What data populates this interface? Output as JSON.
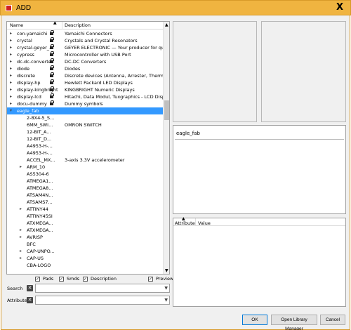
{
  "window": {
    "title": "ADD",
    "close": "X"
  },
  "tree": {
    "headers": {
      "name": "Name",
      "description": "Description"
    },
    "rows": [
      {
        "name": "con-yamaichi",
        "desc": "Yamaichi Connectors",
        "arrow": "▸",
        "lock": true
      },
      {
        "name": "crystal",
        "desc": "Crystals and Crystal Resonators",
        "arrow": "▸",
        "lock": true
      },
      {
        "name": "crystal-geyer_...",
        "desc": "GEYER ELECTRONIC — Your producer for quartz ...",
        "arrow": "▸",
        "lock": true
      },
      {
        "name": "cypress",
        "desc": "Microcontroller with USB Port",
        "arrow": "▸",
        "lock": true
      },
      {
        "name": "dc-dc-converter",
        "desc": "DC-DC Converters",
        "arrow": "▸",
        "lock": true
      },
      {
        "name": "diode",
        "desc": "Diodes",
        "arrow": "▸",
        "lock": true
      },
      {
        "name": "discrete",
        "desc": "Discrete devices (Antenna, Arrester, Thermistor)",
        "arrow": "▸",
        "lock": true
      },
      {
        "name": "display-hp",
        "desc": "Hewlett Packard LED Displays",
        "arrow": "▸",
        "lock": true
      },
      {
        "name": "display-kingbright",
        "desc": "KINGBRIGHT Numeric Displays",
        "arrow": "▸",
        "lock": true
      },
      {
        "name": "display-lcd",
        "desc": "Hitachi, Data Modul, Tuxgraphics - LCD Displays",
        "arrow": "▸",
        "lock": true
      },
      {
        "name": "docu-dummy",
        "desc": "Dummy symbols",
        "arrow": "▸",
        "lock": true
      },
      {
        "name": "eagle_fab",
        "desc": "",
        "arrow": "▾",
        "lock": false,
        "selected": true
      },
      {
        "name": "2-8X4-5_S...",
        "desc": "",
        "arrow": "",
        "child": true
      },
      {
        "name": "6MM_SWI...",
        "desc": "OMRON SWITCH",
        "arrow": "",
        "child": true
      },
      {
        "name": "12-BIT_A...",
        "desc": "",
        "arrow": "",
        "child": true
      },
      {
        "name": "12-BIT_D...",
        "desc": "",
        "arrow": "",
        "child": true
      },
      {
        "name": "A4953-H-...",
        "desc": "",
        "arrow": "",
        "child": true
      },
      {
        "name": "A4953-H-...",
        "desc": "",
        "arrow": "",
        "child": true
      },
      {
        "name": "ACCEL_MX...",
        "desc": "3-axis 3.3V accelerometer",
        "arrow": "",
        "child": true
      },
      {
        "name": "ARM_10",
        "desc": "",
        "arrow": "▸",
        "child": true
      },
      {
        "name": "AS5304-6",
        "desc": "",
        "arrow": "",
        "child": true
      },
      {
        "name": "ATMEGA1...",
        "desc": "",
        "arrow": "",
        "child": true
      },
      {
        "name": "ATMEGA8...",
        "desc": "",
        "arrow": "",
        "child": true
      },
      {
        "name": "ATSAM4N...",
        "desc": "",
        "arrow": "",
        "child": true
      },
      {
        "name": "ATSAMS7...",
        "desc": "",
        "arrow": "",
        "child": true
      },
      {
        "name": "ATTINY44",
        "desc": "",
        "arrow": "▸",
        "child": true
      },
      {
        "name": "ATTINY45SI",
        "desc": "",
        "arrow": "",
        "child": true
      },
      {
        "name": "ATXMEGA...",
        "desc": "",
        "arrow": "",
        "child": true
      },
      {
        "name": "ATXMEGA...",
        "desc": "",
        "arrow": "▸",
        "child": true
      },
      {
        "name": "AVRISP",
        "desc": "",
        "arrow": "▸",
        "child": true
      },
      {
        "name": "BFC",
        "desc": "",
        "arrow": "",
        "child": true
      },
      {
        "name": "CAP-UNPO...",
        "desc": "",
        "arrow": "▸",
        "child": true
      },
      {
        "name": "CAP-US",
        "desc": "",
        "arrow": "▸",
        "child": true
      },
      {
        "name": "CBA-LOGO",
        "desc": "",
        "arrow": "",
        "child": true
      }
    ]
  },
  "filters": {
    "pads": "Pads",
    "smds": "Smds",
    "description": "Description",
    "preview": "Preview"
  },
  "search": {
    "label": "Search",
    "value": ""
  },
  "attributes": {
    "label": "Attributes",
    "value": ""
  },
  "details": {
    "title": "eagle_fab"
  },
  "attr_table": {
    "attribute": "Attribute",
    "value": "Value"
  },
  "buttons": {
    "ok": "OK",
    "open_library_manager": "Open Library Manager",
    "cancel": "Cancel"
  },
  "colors": {
    "titlebar": "#f0b440",
    "selection": "#3399ff"
  }
}
